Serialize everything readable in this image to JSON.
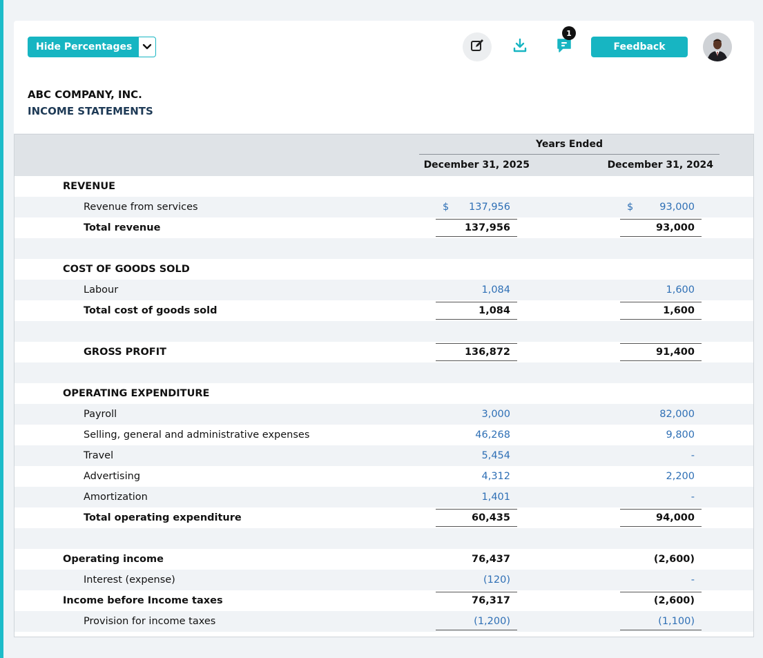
{
  "toolbar": {
    "hide_percentages_label": "Hide Percentages",
    "feedback_label": "Feedback",
    "comment_badge_count": "1",
    "icons": {
      "edit": "edit-icon",
      "download": "download-icon",
      "comment": "comment-icon",
      "dropdown": "chevron-down-icon"
    },
    "accent_color": "#17b5c2"
  },
  "header": {
    "company": "ABC COMPANY, INC.",
    "statement_title": "INCOME STATEMENTS"
  },
  "table": {
    "group_header": "Years Ended",
    "columns": [
      "December 31, 2025",
      "December 31, 2024"
    ],
    "rows": [
      {
        "label": "REVENUE",
        "v1": "",
        "v2": ""
      },
      {
        "label": "Revenue from services",
        "cur1": "$",
        "v1": "137,956",
        "cur2": "$",
        "v2": "93,000"
      },
      {
        "label": "Total revenue",
        "v1": "137,956",
        "v2": "93,000"
      },
      {
        "label": "",
        "v1": "",
        "v2": ""
      },
      {
        "label": "COST OF GOODS SOLD",
        "v1": "",
        "v2": ""
      },
      {
        "label": "Labour",
        "v1": "1,084",
        "v2": "1,600"
      },
      {
        "label": "Total cost of goods sold",
        "v1": "1,084",
        "v2": "1,600"
      },
      {
        "label": "",
        "v1": "",
        "v2": ""
      },
      {
        "label": "GROSS PROFIT",
        "v1": "136,872",
        "v2": "91,400"
      },
      {
        "label": "",
        "v1": "",
        "v2": ""
      },
      {
        "label": "OPERATING EXPENDITURE",
        "v1": "",
        "v2": ""
      },
      {
        "label": "Payroll",
        "v1": "3,000",
        "v2": "82,000"
      },
      {
        "label": "Selling, general and administrative expenses",
        "v1": "46,268",
        "v2": "9,800"
      },
      {
        "label": "Travel",
        "v1": "5,454",
        "v2": "-"
      },
      {
        "label": "Advertising",
        "v1": "4,312",
        "v2": "2,200"
      },
      {
        "label": "Amortization",
        "v1": "1,401",
        "v2": "-"
      },
      {
        "label": "Total operating expenditure",
        "v1": "60,435",
        "v2": "94,000"
      },
      {
        "label": "",
        "v1": "",
        "v2": ""
      },
      {
        "label": "Operating income",
        "v1": "76,437",
        "v2": "(2,600)"
      },
      {
        "label": "Interest (expense)",
        "v1": "(120)",
        "v2": "-"
      },
      {
        "label": "Income before Income taxes",
        "v1": "76,317",
        "v2": "(2,600)"
      },
      {
        "label": "Provision for income taxes",
        "v1": "(1,200)",
        "v2": "(1,100)"
      }
    ]
  }
}
